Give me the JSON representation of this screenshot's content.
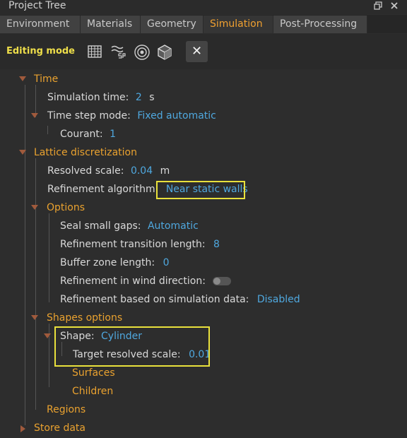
{
  "window": {
    "title": "Project Tree",
    "float_icon": "float-window-icon",
    "close_icon": "close-window-icon"
  },
  "tabs": [
    {
      "label": "Environment"
    },
    {
      "label": "Materials"
    },
    {
      "label": "Geometry"
    },
    {
      "label": "Simulation",
      "active": true
    },
    {
      "label": "Post-Processing"
    }
  ],
  "toolbar": {
    "mode_label": "Editing mode",
    "icons": [
      "grid-table-icon",
      "wind-sp-icon",
      "radar-target-icon",
      "cube-icon"
    ],
    "close_label": "✕"
  },
  "tree": {
    "time": {
      "label": "Time",
      "simulation_time": {
        "label": "Simulation time:",
        "value": "2",
        "unit": "s"
      },
      "time_step_mode": {
        "label": "Time step mode:",
        "value": "Fixed automatic"
      },
      "courant": {
        "label": "Courant:",
        "value": "1"
      }
    },
    "lattice": {
      "label": "Lattice discretization",
      "resolved_scale": {
        "label": "Resolved scale:",
        "value": "0.04",
        "unit": "m"
      },
      "refinement_algorithm": {
        "label": "Refinement algorithm:",
        "value": "Near static walls"
      },
      "options": {
        "label": "Options",
        "seal_small_gaps": {
          "label": "Seal small gaps:",
          "value": "Automatic"
        },
        "transition_length": {
          "label": "Refinement transition length:",
          "value": "8"
        },
        "buffer_zone": {
          "label": "Buffer zone length:",
          "value": "0"
        },
        "wind_direction": {
          "label": "Refinement in wind direction:",
          "enabled": false
        },
        "based_on_sim": {
          "label": "Refinement based on simulation data:",
          "value": "Disabled"
        }
      },
      "shapes_options": {
        "label": "Shapes options",
        "shape": {
          "label": "Shape:",
          "value": "Cylinder"
        },
        "target_resolved_scale": {
          "label": "Target resolved scale:",
          "value": "0.01"
        },
        "surfaces": "Surfaces",
        "children": "Children"
      },
      "regions": "Regions"
    },
    "store_data": "Store data"
  },
  "colors": {
    "section": "#eaa22f",
    "value": "#4fa8df",
    "highlight": "#e9e13c",
    "mode": "#eede4a"
  }
}
